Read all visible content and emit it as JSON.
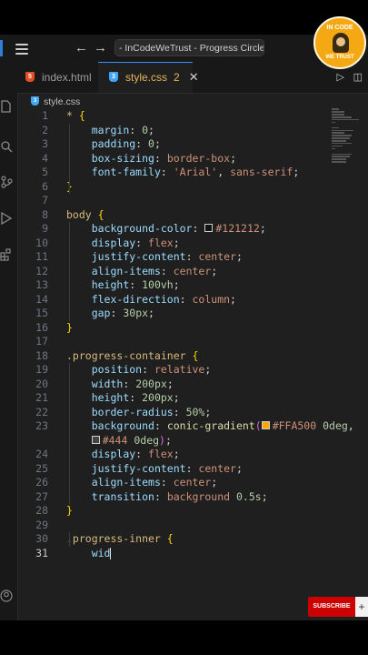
{
  "titlebar": {
    "back_icon": "arrow-left-icon",
    "forward_icon": "arrow-right-icon",
    "title": "- InCodeWeTrust - Progress Circle with"
  },
  "tabs": [
    {
      "label": "index.html",
      "icon": "html5-icon",
      "active": false
    },
    {
      "label": "style.css",
      "icon": "css3-icon",
      "active": true,
      "problems": "2"
    }
  ],
  "breadcrumb": {
    "file": "style.css"
  },
  "editor": {
    "current_line": 31,
    "lines": [
      {
        "n": "1",
        "tokens": [
          [
            "sel",
            "* "
          ],
          [
            "brace",
            "{"
          ]
        ]
      },
      {
        "n": "2",
        "tokens": [
          [
            "pad",
            "    "
          ],
          [
            "prop",
            "margin"
          ],
          [
            "punc",
            ": "
          ],
          [
            "num",
            "0"
          ],
          [
            "punc",
            ";"
          ]
        ]
      },
      {
        "n": "3",
        "tokens": [
          [
            "pad",
            "    "
          ],
          [
            "prop",
            "padding"
          ],
          [
            "punc",
            ": "
          ],
          [
            "num",
            "0"
          ],
          [
            "punc",
            ";"
          ]
        ]
      },
      {
        "n": "4",
        "tokens": [
          [
            "pad",
            "    "
          ],
          [
            "prop",
            "box-sizing"
          ],
          [
            "punc",
            ": "
          ],
          [
            "val",
            "border-box"
          ],
          [
            "punc",
            ";"
          ]
        ]
      },
      {
        "n": "5",
        "tokens": [
          [
            "pad",
            "    "
          ],
          [
            "prop",
            "font-family"
          ],
          [
            "punc",
            ": "
          ],
          [
            "val",
            "'Arial'"
          ],
          [
            "punc",
            ", "
          ],
          [
            "val",
            "sans-serif"
          ],
          [
            "punc",
            ";"
          ]
        ]
      },
      {
        "n": "6",
        "tokens": [
          [
            "brace",
            "}"
          ]
        ]
      },
      {
        "n": "7",
        "tokens": []
      },
      {
        "n": "8",
        "tokens": [
          [
            "sel",
            "body "
          ],
          [
            "brace",
            "{"
          ]
        ]
      },
      {
        "n": "9",
        "tokens": [
          [
            "pad",
            "    "
          ],
          [
            "prop",
            "background-color"
          ],
          [
            "punc",
            ": "
          ],
          [
            "swatch",
            "#121212"
          ],
          [
            "val",
            "#121212"
          ],
          [
            "punc",
            ";"
          ]
        ]
      },
      {
        "n": "10",
        "tokens": [
          [
            "pad",
            "    "
          ],
          [
            "prop",
            "display"
          ],
          [
            "punc",
            ": "
          ],
          [
            "val",
            "flex"
          ],
          [
            "punc",
            ";"
          ]
        ]
      },
      {
        "n": "11",
        "tokens": [
          [
            "pad",
            "    "
          ],
          [
            "prop",
            "justify-content"
          ],
          [
            "punc",
            ": "
          ],
          [
            "val",
            "center"
          ],
          [
            "punc",
            ";"
          ]
        ]
      },
      {
        "n": "12",
        "tokens": [
          [
            "pad",
            "    "
          ],
          [
            "prop",
            "align-items"
          ],
          [
            "punc",
            ": "
          ],
          [
            "val",
            "center"
          ],
          [
            "punc",
            ";"
          ]
        ]
      },
      {
        "n": "13",
        "tokens": [
          [
            "pad",
            "    "
          ],
          [
            "prop",
            "height"
          ],
          [
            "punc",
            ": "
          ],
          [
            "num",
            "100vh"
          ],
          [
            "punc",
            ";"
          ]
        ]
      },
      {
        "n": "14",
        "tokens": [
          [
            "pad",
            "    "
          ],
          [
            "prop",
            "flex-direction"
          ],
          [
            "punc",
            ": "
          ],
          [
            "val",
            "column"
          ],
          [
            "punc",
            ";"
          ]
        ]
      },
      {
        "n": "15",
        "tokens": [
          [
            "pad",
            "    "
          ],
          [
            "prop",
            "gap"
          ],
          [
            "punc",
            ": "
          ],
          [
            "num",
            "30px"
          ],
          [
            "punc",
            ";"
          ]
        ]
      },
      {
        "n": "16",
        "tokens": [
          [
            "brace",
            "}"
          ]
        ]
      },
      {
        "n": "17",
        "tokens": []
      },
      {
        "n": "18",
        "tokens": [
          [
            "sel",
            ".progress-container "
          ],
          [
            "brace",
            "{"
          ]
        ]
      },
      {
        "n": "19",
        "tokens": [
          [
            "pad",
            "    "
          ],
          [
            "prop",
            "position"
          ],
          [
            "punc",
            ": "
          ],
          [
            "val",
            "relative"
          ],
          [
            "punc",
            ";"
          ]
        ]
      },
      {
        "n": "20",
        "tokens": [
          [
            "pad",
            "    "
          ],
          [
            "prop",
            "width"
          ],
          [
            "punc",
            ": "
          ],
          [
            "num",
            "200px"
          ],
          [
            "punc",
            ";"
          ]
        ]
      },
      {
        "n": "21",
        "tokens": [
          [
            "pad",
            "    "
          ],
          [
            "prop",
            "height"
          ],
          [
            "punc",
            ": "
          ],
          [
            "num",
            "200px"
          ],
          [
            "punc",
            ";"
          ]
        ]
      },
      {
        "n": "22",
        "tokens": [
          [
            "pad",
            "    "
          ],
          [
            "prop",
            "border-radius"
          ],
          [
            "punc",
            ": "
          ],
          [
            "num",
            "50%"
          ],
          [
            "punc",
            ";"
          ]
        ]
      },
      {
        "n": "23",
        "tokens": [
          [
            "pad",
            "    "
          ],
          [
            "prop",
            "background"
          ],
          [
            "punc",
            ": "
          ],
          [
            "func",
            "conic-gradient"
          ],
          [
            "brace2",
            "("
          ],
          [
            "swatch",
            "#FFA500"
          ],
          [
            "val",
            "#FFA500"
          ],
          [
            "punc",
            " "
          ],
          [
            "num",
            "0deg"
          ],
          [
            "punc",
            ","
          ]
        ]
      },
      {
        "n": "",
        "tokens": [
          [
            "pad",
            "    "
          ],
          [
            "swatch",
            "#444"
          ],
          [
            "val",
            "#444"
          ],
          [
            "punc",
            " "
          ],
          [
            "num",
            "0deg"
          ],
          [
            "brace2",
            ")"
          ],
          [
            "punc",
            ";"
          ]
        ]
      },
      {
        "n": "24",
        "tokens": [
          [
            "pad",
            "    "
          ],
          [
            "prop",
            "display"
          ],
          [
            "punc",
            ": "
          ],
          [
            "val",
            "flex"
          ],
          [
            "punc",
            ";"
          ]
        ]
      },
      {
        "n": "25",
        "tokens": [
          [
            "pad",
            "    "
          ],
          [
            "prop",
            "justify-content"
          ],
          [
            "punc",
            ": "
          ],
          [
            "val",
            "center"
          ],
          [
            "punc",
            ";"
          ]
        ]
      },
      {
        "n": "26",
        "tokens": [
          [
            "pad",
            "    "
          ],
          [
            "prop",
            "align-items"
          ],
          [
            "punc",
            ": "
          ],
          [
            "val",
            "center"
          ],
          [
            "punc",
            ";"
          ]
        ]
      },
      {
        "n": "27",
        "tokens": [
          [
            "pad",
            "    "
          ],
          [
            "prop",
            "transition"
          ],
          [
            "punc",
            ": "
          ],
          [
            "val",
            "background"
          ],
          [
            "punc",
            " "
          ],
          [
            "num",
            "0.5s"
          ],
          [
            "punc",
            ";"
          ]
        ]
      },
      {
        "n": "28",
        "tokens": [
          [
            "brace",
            "}"
          ]
        ]
      },
      {
        "n": "29",
        "tokens": []
      },
      {
        "n": "30",
        "tokens": [
          [
            "sel",
            ".progress-inner "
          ],
          [
            "brace",
            "{"
          ]
        ]
      },
      {
        "n": "31",
        "tokens": [
          [
            "pad",
            "    "
          ],
          [
            "prop",
            "wid"
          ],
          [
            "cursor",
            ""
          ]
        ]
      }
    ]
  },
  "badge": {
    "top": "IN CODE",
    "bottom": "WE TRUST"
  },
  "subscribe": {
    "label": "SUBSCRIBE",
    "plus": "+"
  },
  "colors": {
    "accent": "#3794ff",
    "modified_tab": "#e4b55b",
    "badge": "#f4a914",
    "subscribe": "#cc0000"
  }
}
